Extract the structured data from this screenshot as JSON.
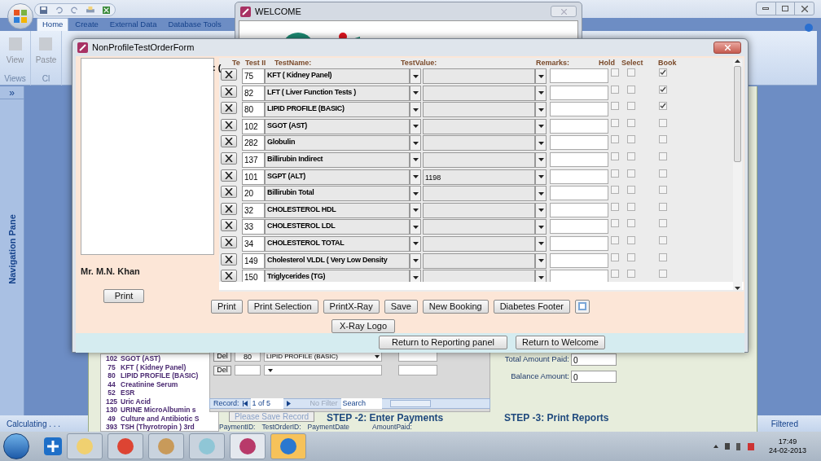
{
  "app": {
    "tabs": [
      {
        "label": "Home",
        "selected": true
      },
      {
        "label": "Create",
        "selected": false
      },
      {
        "label": "External Data",
        "selected": false
      },
      {
        "label": "Database Tools",
        "selected": false
      }
    ],
    "ribbon": {
      "buttons": [
        "View",
        "Paste"
      ],
      "groups": [
        "Views",
        "Cl"
      ]
    },
    "nav_pane": {
      "toggle": "»",
      "title": "Navigation Pane"
    },
    "status_bar": {
      "left": "Calculating . . .",
      "right": "Filtered"
    }
  },
  "back_form": {
    "tests": [
      {
        "code": "102",
        "name": "SGOT (AST)"
      },
      {
        "code": "75",
        "name": "KFT ( Kidney Panel)"
      },
      {
        "code": "80",
        "name": "LIPID PROFILE (BASIC)"
      },
      {
        "code": "44",
        "name": "Creatinine Serum"
      },
      {
        "code": "52",
        "name": "ESR"
      },
      {
        "code": "125",
        "name": "Uric Acid"
      },
      {
        "code": "130",
        "name": "URINE MicroAlbumin s"
      },
      {
        "code": "49",
        "name": "Culture and Antibiotic S"
      },
      {
        "code": "393",
        "name": "TSH (Thyrotropin ) 3rd"
      }
    ],
    "subform_rows": [
      {
        "button": "Del",
        "id": "80",
        "name": "LIPID PROFILE (BASIC)"
      },
      {
        "button": "Del"
      }
    ],
    "record_nav": {
      "label": "Record:",
      "position": "1 of 5",
      "filter": "No Filter",
      "search": "Search"
    },
    "save_button": {
      "label": "Please Save Record",
      "disabled": true
    },
    "step2": "STEP -2: Enter Payments",
    "payment_columns": [
      "PaymentID:",
      "TestOrderID:",
      "PaymentDate",
      "AmountPaid:"
    ],
    "totals": [
      {
        "label": "Total Amount Paid:",
        "value": "0"
      },
      {
        "label": "Balance Amount:",
        "value": "0"
      }
    ],
    "step3": "STEP -3: Print Reports"
  },
  "welcome_window": {
    "title": "WELCOME"
  },
  "order_form": {
    "title": "NonProfileTestOrderForm",
    "patient": "Mr. M.N. Khan",
    "print_button": "Print",
    "cut_label": ": (",
    "columns": [
      "Te",
      "Test II",
      "TestName:",
      "TestValue:",
      "Remarks:",
      "Hold",
      "Select",
      "Book"
    ],
    "rows": [
      {
        "id": "75",
        "name": "KFT ( Kidney Panel)",
        "hold": false,
        "select": false,
        "book": true
      },
      {
        "id": "82",
        "name": "LFT ( Liver Function Tests )",
        "hold": false,
        "select": false,
        "book": true
      },
      {
        "id": "80",
        "name": "LIPID PROFILE (BASIC)",
        "hold": false,
        "select": false,
        "book": true
      },
      {
        "id": "102",
        "name": "SGOT (AST)",
        "hold": false,
        "select": false,
        "book": false
      },
      {
        "id": "282",
        "name": "Globulin",
        "hold": false,
        "select": false,
        "book": false
      },
      {
        "id": "137",
        "name": "Billirubin Indirect",
        "hold": false,
        "select": false,
        "book": false
      },
      {
        "id": "101",
        "name": "SGPT (ALT)",
        "value": "1198",
        "hold": false,
        "select": false,
        "book": false
      },
      {
        "id": "20",
        "name": "Billirubin Total",
        "hold": false,
        "select": false,
        "book": false
      },
      {
        "id": "32",
        "name": "CHOLESTEROL HDL",
        "hold": false,
        "select": false,
        "book": false
      },
      {
        "id": "33",
        "name": "CHOLESTEROL LDL",
        "hold": false,
        "select": false,
        "book": false
      },
      {
        "id": "34",
        "name": "CHOLESTEROL TOTAL",
        "hold": false,
        "select": false,
        "book": false
      },
      {
        "id": "149",
        "name": "Cholesterol VLDL ( Very Low Density",
        "hold": false,
        "select": false,
        "book": false
      },
      {
        "id": "150",
        "name": "Triglycerides (TG)",
        "hold": false,
        "select": false,
        "book": false
      }
    ],
    "buttons": [
      "Print",
      "Print Selection",
      "PrintX-Ray",
      "Save",
      "New Booking",
      "Diabetes Footer"
    ],
    "logo_button": "X-Ray Logo",
    "footer_buttons": [
      "Return to Reporting panel",
      "Return to Welcome"
    ]
  },
  "taskbar": {
    "time": "17:49",
    "date": "24-02-2013"
  }
}
